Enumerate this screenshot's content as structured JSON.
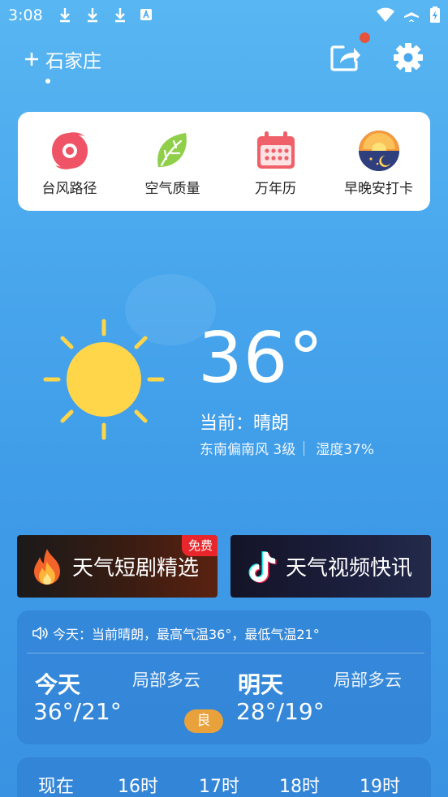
{
  "status_bar": {
    "time": "3:08",
    "icons": [
      "download-icon",
      "download-icon",
      "download-icon",
      "a-notification-icon",
      "wifi-icon",
      "airplane-icon",
      "battery-charging-icon"
    ]
  },
  "header": {
    "city": "石家庄",
    "share_has_notification": true
  },
  "tools": [
    {
      "label": "台风路径",
      "icon": "typhoon-icon"
    },
    {
      "label": "空气质量",
      "icon": "leaf-icon"
    },
    {
      "label": "万年历",
      "icon": "calendar-icon"
    },
    {
      "label": "早晚安打卡",
      "icon": "sunset-icon"
    }
  ],
  "current": {
    "temperature": "36°",
    "condition": "当前：晴朗",
    "wind": "东南偏南风 3级",
    "humidity": "湿度37%"
  },
  "promos": {
    "left_label": "天气短剧精选",
    "left_badge": "免费",
    "right_label": "天气视频快讯"
  },
  "forecast": {
    "summary": "今天：当前晴朗，最高气温36°，最低气温21°",
    "today": {
      "label": "今天",
      "desc": "局部多云",
      "range": "36°/21°",
      "aqi": "良"
    },
    "tomorrow": {
      "label": "明天",
      "desc": "局部多云",
      "range": "28°/19°"
    }
  },
  "hourly": [
    "现在",
    "16时",
    "17时",
    "18时",
    "19时"
  ],
  "colors": {
    "aqi_good": "#e9a13c",
    "notification_dot": "#e5533d",
    "free_badge": "#e8262b"
  }
}
